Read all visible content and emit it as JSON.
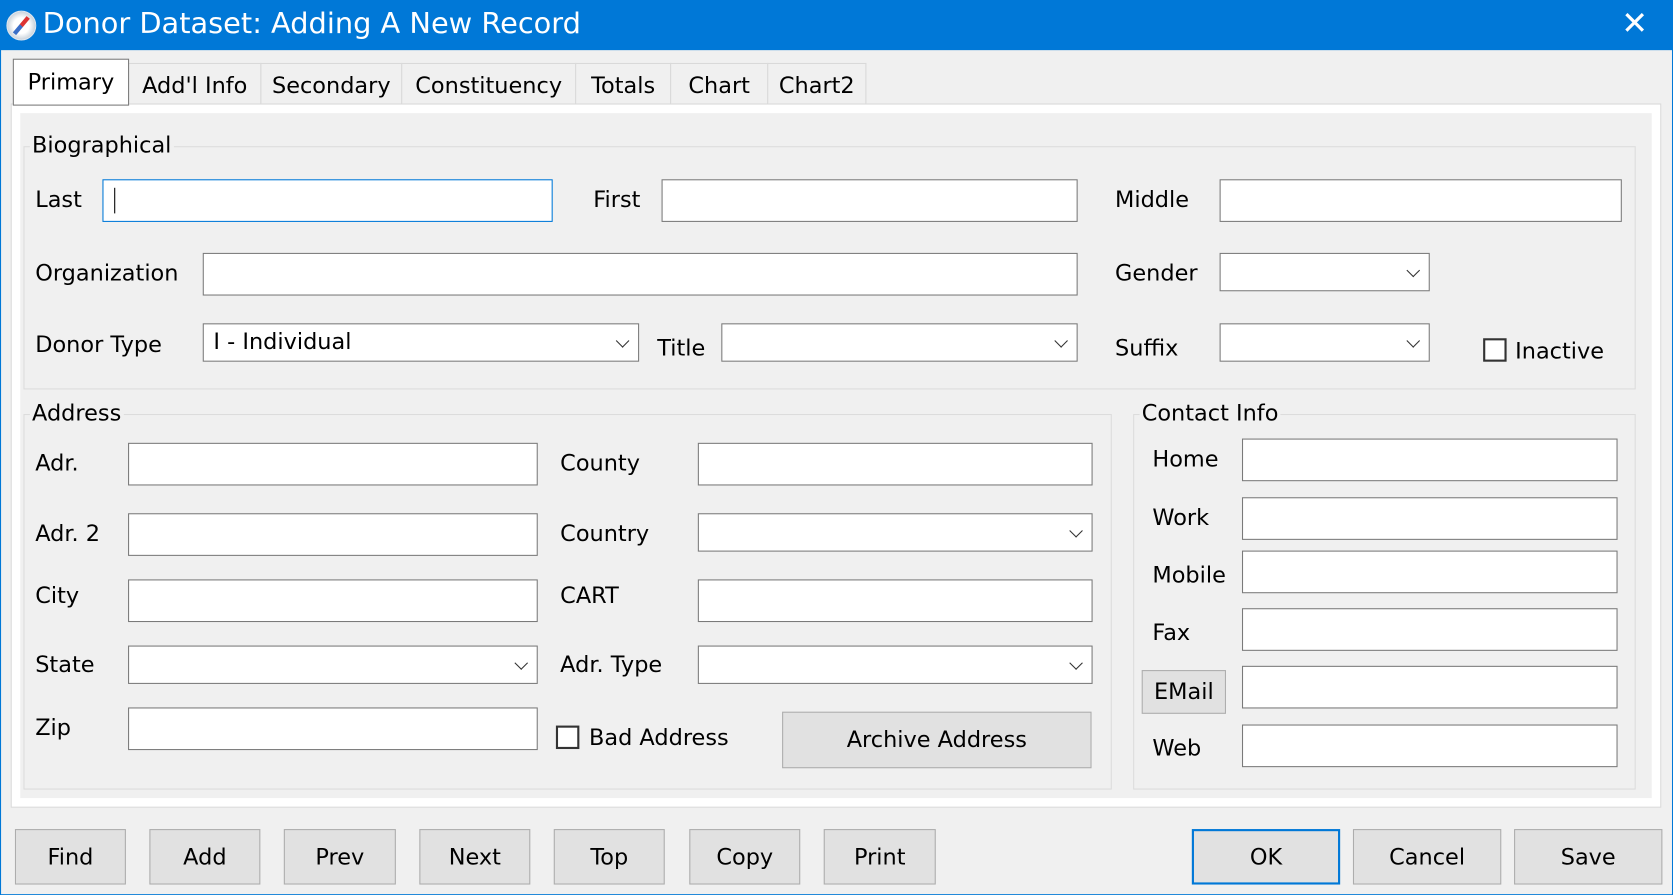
{
  "window": {
    "title": "Donor Dataset: Adding A New Record",
    "close_label": "✕",
    "accent_color": "#0078d7"
  },
  "tabs": [
    {
      "label": "Primary",
      "selected": true
    },
    {
      "label": "Add'l Info"
    },
    {
      "label": "Secondary"
    },
    {
      "label": "Constituency"
    },
    {
      "label": "Totals"
    },
    {
      "label": "Chart"
    },
    {
      "label": "Chart2"
    }
  ],
  "biographical": {
    "title": "Biographical",
    "last_label": "Last",
    "last_value": "",
    "first_label": "First",
    "first_value": "",
    "middle_label": "Middle",
    "middle_value": "",
    "organization_label": "Organization",
    "organization_value": "",
    "gender_label": "Gender",
    "gender_value": "",
    "donor_type_label": "Donor Type",
    "donor_type_value": "I - Individual",
    "title_label": "Title",
    "title_value": "",
    "suffix_label": "Suffix",
    "suffix_value": "",
    "inactive_label": "Inactive",
    "inactive_checked": false
  },
  "address": {
    "title": "Address",
    "adr_label": "Adr.",
    "adr2_label": "Adr. 2",
    "city_label": "City",
    "state_label": "State",
    "zip_label": "Zip",
    "county_label": "County",
    "country_label": "Country",
    "cart_label": "CART",
    "adr_type_label": "Adr. Type",
    "bad_address_label": "Bad Address",
    "bad_address_checked": false,
    "archive_button": "Archive Address"
  },
  "contact": {
    "title": "Contact Info",
    "home_label": "Home",
    "work_label": "Work",
    "mobile_label": "Mobile",
    "fax_label": "Fax",
    "email_button": "EMail",
    "web_label": "Web"
  },
  "buttons": {
    "find": "Find",
    "add": "Add",
    "prev": "Prev",
    "next": "Next",
    "top": "Top",
    "copy": "Copy",
    "print": "Print",
    "ok": "OK",
    "cancel": "Cancel",
    "save": "Save"
  }
}
